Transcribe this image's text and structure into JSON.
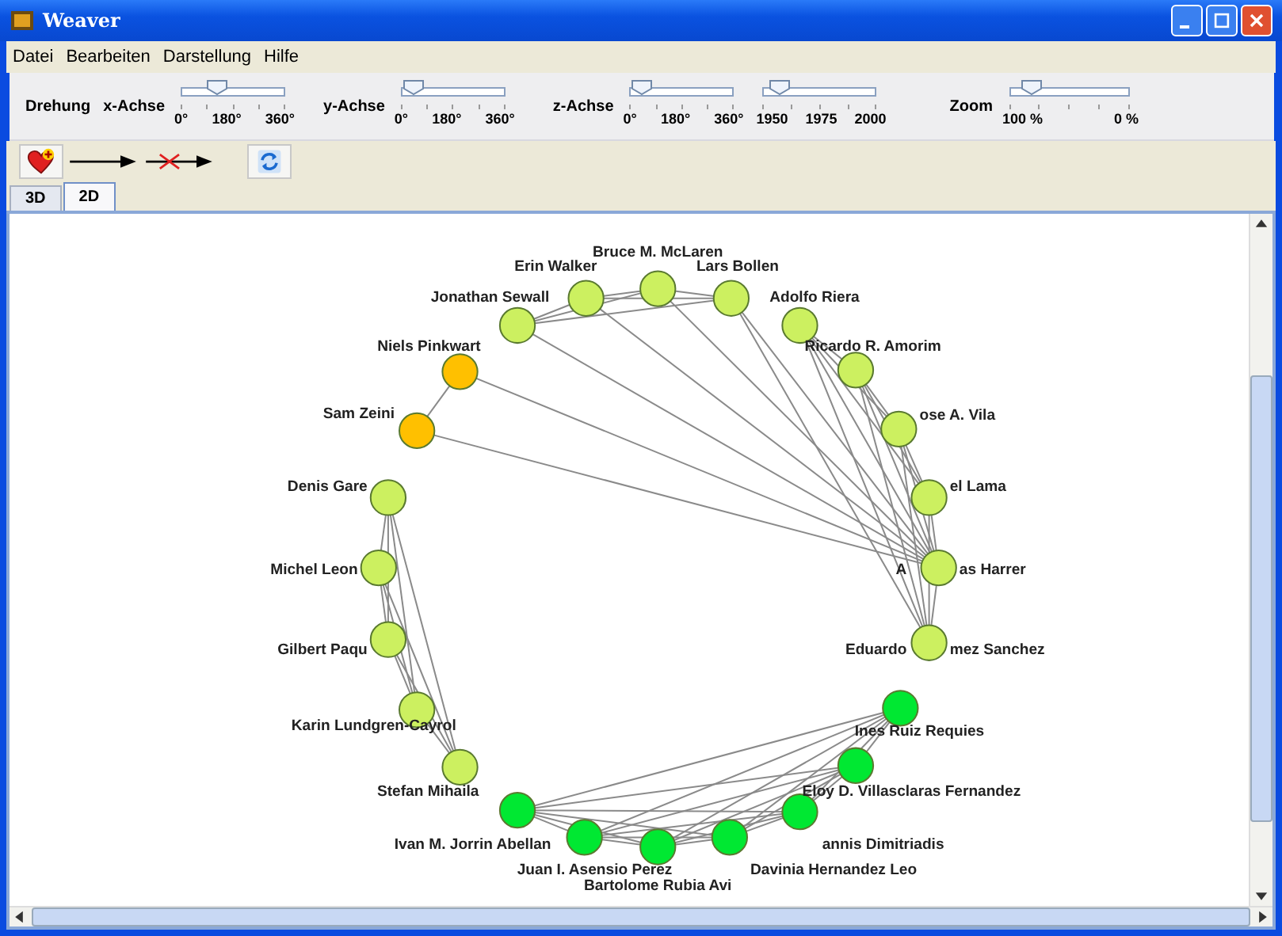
{
  "window": {
    "title": "Weaver"
  },
  "menu": [
    "Datei",
    "Bearbeiten",
    "Darstellung",
    "Hilfe"
  ],
  "controls": {
    "label": "Drehung",
    "sliders": [
      {
        "label": "x-Achse",
        "level": 0.3,
        "ticks": [
          "0°",
          "180°",
          "360°"
        ]
      },
      {
        "label": "y-Achse",
        "level": 0.0,
        "ticks": [
          "0°",
          "180°",
          "360°"
        ]
      },
      {
        "label": "z-Achse",
        "level": 0.0,
        "ticks": [
          "0°",
          "180°",
          "360°"
        ]
      },
      {
        "level": 0.05,
        "ticks": [
          "1950",
          "1975",
          "2000"
        ]
      },
      {
        "label": "Zoom",
        "level": 0.1,
        "ticks": [
          "100 %",
          "0 %"
        ]
      }
    ]
  },
  "tabs": [
    {
      "label": "3D",
      "selected": false
    },
    {
      "label": "2D",
      "selected": true
    }
  ],
  "graph": {
    "nodes": [
      {
        "label": "Bruce M. McLaren",
        "color": "#ccf060"
      },
      {
        "label": "Erin Walker",
        "color": "#ccf060"
      },
      {
        "label": "Lars Bollen",
        "color": "#ccf060"
      },
      {
        "label": "Jonathan Sewall",
        "color": "#ccf060"
      },
      {
        "label": "Adolfo Riera",
        "color": "#ccf060"
      },
      {
        "label": "Niels Pinkwart",
        "color": "#ffc000"
      },
      {
        "label": "Ricardo R. Amorim",
        "color": "#ccf060"
      },
      {
        "label": "Sam Zeini",
        "color": "#ffc000"
      },
      {
        "label": "ose A. Vila",
        "color": "#ccf060"
      },
      {
        "label": "Denis Gare",
        "color": "#ccf060"
      },
      {
        "label": "el Lama",
        "color": "#ccf060"
      },
      {
        "label": "Michel Leon",
        "color": "#ccf060"
      },
      {
        "label": "as Harrer",
        "label_left": "A",
        "color": "#ccf060"
      },
      {
        "label": "Gilbert Paqu",
        "color": "#ccf060"
      },
      {
        "label": "mez Sanchez",
        "label_left": "Eduardo",
        "color": "#ccf060"
      },
      {
        "label": "Karin Lundgren-Cayrol",
        "color": "#ccf060"
      },
      {
        "label": "Ines Ruiz Requies",
        "color": "#00e832"
      },
      {
        "label": "Stefan Mihaila",
        "color": "#ccf060"
      },
      {
        "label": "Eloy D. Villasclaras Fernandez",
        "color": "#00e832"
      },
      {
        "label": "Ivan M. Jorrin Abellan",
        "color": "#00e832"
      },
      {
        "label": "annis Dimitriadis",
        "color": "#00e832"
      },
      {
        "label": "Juan I. Asensio Perez",
        "color": "#00e832"
      },
      {
        "label": "Davinia Hernandez Leo",
        "color": "#00e832"
      },
      {
        "label": "Bartolome Rubia Avi",
        "color": "#00e832"
      }
    ]
  }
}
